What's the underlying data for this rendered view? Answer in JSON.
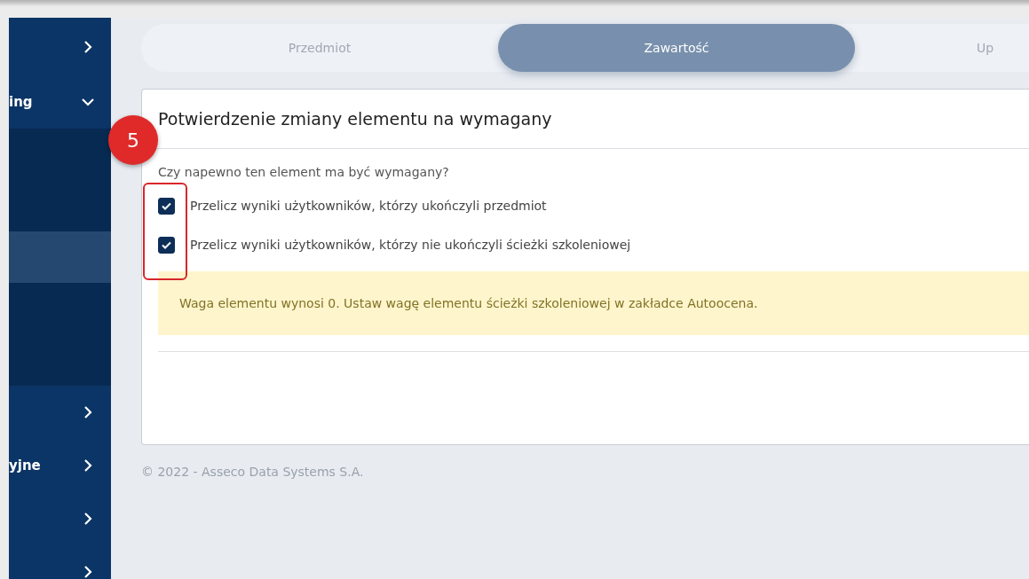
{
  "sidebar": {
    "items": [
      {
        "expanded": false
      },
      {
        "label": "ing",
        "expanded": true,
        "children": [
          {
            "selected": false
          },
          {
            "selected": false
          },
          {
            "selected": true
          },
          {
            "selected": false
          },
          {
            "selected": false
          }
        ]
      },
      {
        "expanded": false
      },
      {
        "label": "yjne",
        "expanded": false
      },
      {
        "expanded": false
      },
      {
        "expanded": false
      }
    ]
  },
  "tabs": [
    {
      "label": "Przedmiot",
      "selected": false
    },
    {
      "label": "Zawartość",
      "selected": true
    },
    {
      "label": "Up",
      "selected": false
    }
  ],
  "dialog": {
    "title": "Potwierdzenie zmiany elementu na wymagany",
    "question": "Czy napewno ten element ma być wymagany?",
    "options": [
      {
        "label": "Przelicz wyniki użytkowników, którzy ukończyli przedmiot",
        "checked": true
      },
      {
        "label": "Przelicz wyniki użytkowników, którzy nie ukończyli ścieżki szkoleniowej",
        "checked": true
      }
    ],
    "warning": "Waga elementu wynosi 0. Ustaw wagę elementu ścieżki szkoleniowej w zakładce Autoocena."
  },
  "footer": "© 2022 - Asseco Data Systems S.A.",
  "annotation": {
    "number": "5"
  }
}
